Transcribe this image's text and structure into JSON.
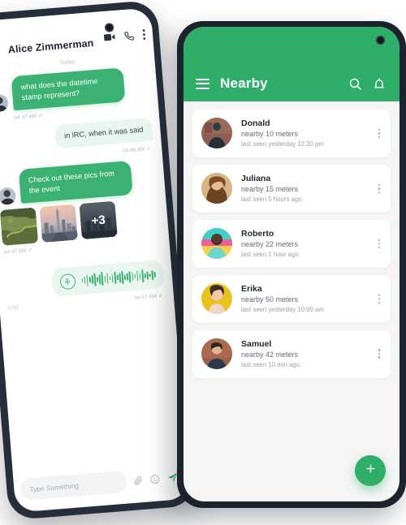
{
  "chat": {
    "contact_name": "Alice Zimmerman",
    "back_icon": "back-arrow-icon",
    "video_icon": "video-camera-icon",
    "call_icon": "phone-icon",
    "overflow_icon": "more-vertical-icon",
    "day_divider": "Today",
    "messages": [
      {
        "direction": "in",
        "text": "what does the datetime stamp represent?",
        "time": "04:47 AM",
        "tick": "✓"
      },
      {
        "direction": "out",
        "text": "in iRC, when it was said",
        "time": "04:48 AM",
        "tick": "✓"
      },
      {
        "direction": "in",
        "text": "Check out these pics from the event",
        "time": "04:47 AM",
        "tick": "✓"
      }
    ],
    "photo_attachment": {
      "count_overlay": "+3",
      "time": "04:47 AM",
      "tick": "✓"
    },
    "voice_message": {
      "duration": "0:30",
      "time": "04:47 AM",
      "tick": "✓",
      "mic_icon": "microphone-icon"
    },
    "composer": {
      "placeholder": "Type Something",
      "value": "",
      "attach_icon": "paperclip-icon",
      "emoji_icon": "emoji-smiley-icon",
      "send_icon": "send-paper-plane-icon"
    }
  },
  "nearby": {
    "title": "Nearby",
    "menu_icon": "hamburger-menu-icon",
    "search_icon": "search-icon",
    "notification_icon": "bell-icon",
    "fab_label": "+",
    "fab_icon": "plus-icon",
    "people": [
      {
        "name": "Donald",
        "distance": "nearby 10 meters",
        "last_seen": "last seen yesterday 12:30 pm"
      },
      {
        "name": "Juliana",
        "distance": "nearby 15 meters",
        "last_seen": "last seen 5 hours ago"
      },
      {
        "name": "Roberto",
        "distance": "nearby 22 meters",
        "last_seen": "last seen 1 hour ago"
      },
      {
        "name": "Erika",
        "distance": "nearby 50 meters",
        "last_seen": "last seen yesterday 10:00 am"
      },
      {
        "name": "Samuel",
        "distance": "nearby 42 meters",
        "last_seen": "last seen 10 min ago"
      }
    ]
  },
  "colors": {
    "brand_green": "#2eae68",
    "bubble_in": "#3bb273",
    "bubble_out": "#e9f6ef",
    "phone_frame": "#272e3b",
    "list_background": "#f5f5f5"
  }
}
